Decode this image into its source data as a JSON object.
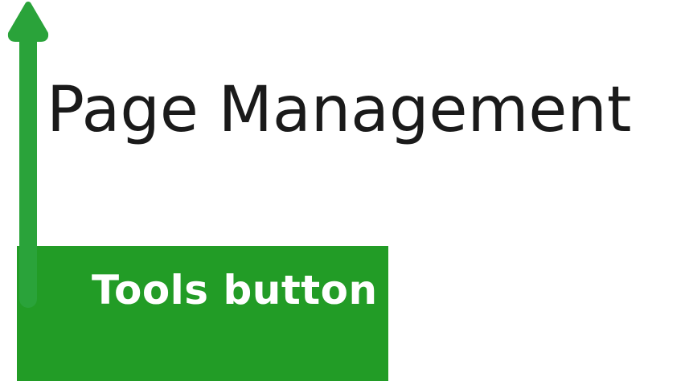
{
  "page": {
    "title": "Page Management"
  },
  "callout": {
    "label": "Tools button",
    "color": "#229c26",
    "arrow_color": "#2aa33a",
    "arrow_direction": "up",
    "arrow_icon": "arrow-up-icon"
  }
}
